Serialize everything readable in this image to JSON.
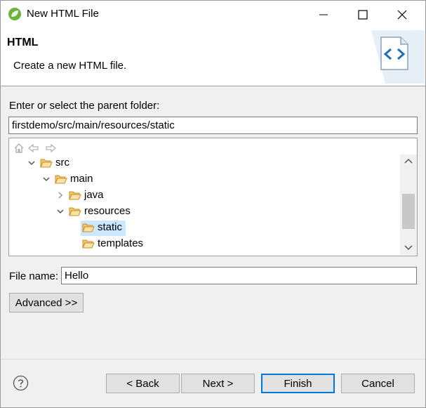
{
  "window": {
    "title": "New HTML File"
  },
  "header": {
    "title": "HTML",
    "description": "Create a new HTML file."
  },
  "folder": {
    "label": "Enter or select the parent folder:",
    "value": "firstdemo/src/main/resources/static"
  },
  "tree": {
    "items": [
      {
        "label": "src",
        "expanded": true
      },
      {
        "label": "main",
        "expanded": true
      },
      {
        "label": "java",
        "expanded": false
      },
      {
        "label": "resources",
        "expanded": true
      },
      {
        "label": "static",
        "selected": true
      },
      {
        "label": "templates"
      }
    ]
  },
  "file_name": {
    "label": "File name:",
    "value": "Hello"
  },
  "buttons": {
    "advanced": "Advanced >>",
    "back": "< Back",
    "next": "Next >",
    "finish": "Finish",
    "cancel": "Cancel"
  },
  "colors": {
    "selection": "#cce8ff",
    "default_button_border": "#0078d7",
    "folder_icon": "#e8a93a"
  }
}
